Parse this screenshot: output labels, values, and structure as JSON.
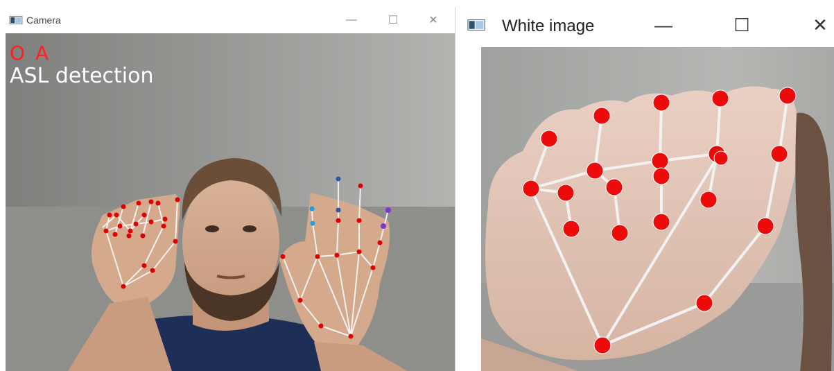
{
  "windows": {
    "camera": {
      "title": "Camera",
      "prediction": "O A",
      "label": "ASL detection",
      "controls": {
        "minimize": "—",
        "maximize": "☐",
        "close": "✕"
      }
    },
    "white_image": {
      "title": "White image",
      "controls": {
        "minimize": "—",
        "maximize": "☐",
        "close": "✕"
      }
    }
  },
  "colors": {
    "prediction_text": "#ff2020",
    "label_text": "#ffffff",
    "landmark": "#e00000",
    "connection": "#f2f2f2",
    "thumb_tip_left": "#6a5cff",
    "index_tip_left": "#2f7fd8"
  },
  "icons": {
    "app": "window-app-icon"
  }
}
